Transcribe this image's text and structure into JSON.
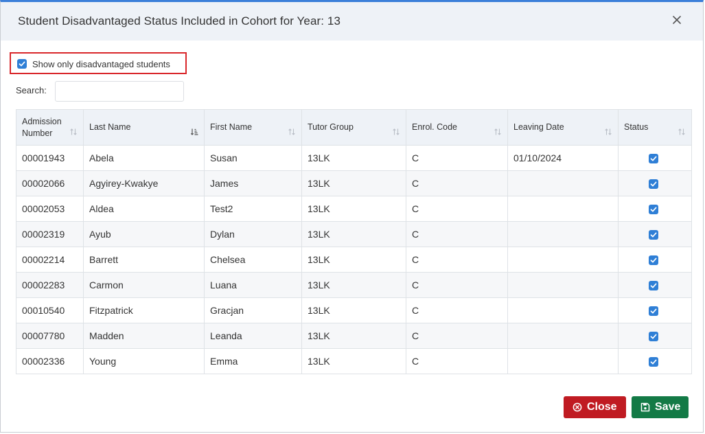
{
  "dialog": {
    "title": "Student Disadvantaged Status Included in Cohort for Year: 13"
  },
  "filter": {
    "label": "Show only disadvantaged students",
    "checked": true
  },
  "search": {
    "label": "Search:",
    "value": "",
    "placeholder": ""
  },
  "table": {
    "columns": [
      {
        "key": "admission",
        "label": "Admission Number",
        "sort": "none"
      },
      {
        "key": "last_name",
        "label": "Last Name",
        "sort": "ascending"
      },
      {
        "key": "first_name",
        "label": "First Name",
        "sort": "none"
      },
      {
        "key": "tutor_group",
        "label": "Tutor Group",
        "sort": "none"
      },
      {
        "key": "enrol_code",
        "label": "Enrol. Code",
        "sort": "none"
      },
      {
        "key": "leaving_date",
        "label": "Leaving Date",
        "sort": "none"
      },
      {
        "key": "status",
        "label": "Status",
        "sort": "none"
      }
    ],
    "rows": [
      {
        "admission": "00001943",
        "last_name": "Abela",
        "first_name": "Susan",
        "tutor_group": "13LK",
        "enrol_code": "C",
        "leaving_date": "01/10/2024",
        "status": true
      },
      {
        "admission": "00002066",
        "last_name": "Agyirey-Kwakye",
        "first_name": "James",
        "tutor_group": "13LK",
        "enrol_code": "C",
        "leaving_date": "",
        "status": true
      },
      {
        "admission": "00002053",
        "last_name": "Aldea",
        "first_name": "Test2",
        "tutor_group": "13LK",
        "enrol_code": "C",
        "leaving_date": "",
        "status": true
      },
      {
        "admission": "00002319",
        "last_name": "Ayub",
        "first_name": "Dylan",
        "tutor_group": "13LK",
        "enrol_code": "C",
        "leaving_date": "",
        "status": true
      },
      {
        "admission": "00002214",
        "last_name": "Barrett",
        "first_name": "Chelsea",
        "tutor_group": "13LK",
        "enrol_code": "C",
        "leaving_date": "",
        "status": true
      },
      {
        "admission": "00002283",
        "last_name": "Carmon",
        "first_name": "Luana",
        "tutor_group": "13LK",
        "enrol_code": "C",
        "leaving_date": "",
        "status": true
      },
      {
        "admission": "00010540",
        "last_name": "Fitzpatrick",
        "first_name": "Gracjan",
        "tutor_group": "13LK",
        "enrol_code": "C",
        "leaving_date": "",
        "status": true
      },
      {
        "admission": "00007780",
        "last_name": "Madden",
        "first_name": "Leanda",
        "tutor_group": "13LK",
        "enrol_code": "C",
        "leaving_date": "",
        "status": true
      },
      {
        "admission": "00002336",
        "last_name": "Young",
        "first_name": "Emma",
        "tutor_group": "13LK",
        "enrol_code": "C",
        "leaving_date": "",
        "status": true
      }
    ]
  },
  "buttons": {
    "close_label": "Close",
    "save_label": "Save"
  },
  "icons": {
    "dialog_close": "close-x-icon",
    "close_button": "circle-x-icon",
    "save_button": "floppy-disk-icon",
    "sort_none": "sort-updown-icon",
    "sort_ascending": "sort-amount-down-icon"
  },
  "colors": {
    "accent": "#2f7fd6",
    "header_bg": "#eef2f7",
    "close_button": "#c01b22",
    "save_button": "#137a46",
    "highlight_border": "#d9262a"
  }
}
